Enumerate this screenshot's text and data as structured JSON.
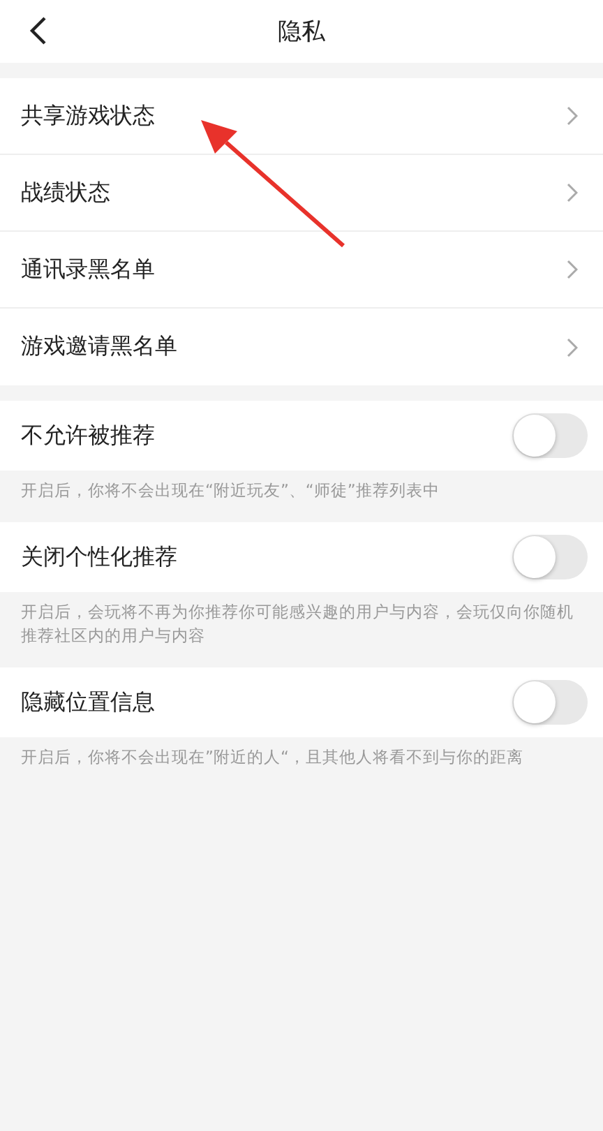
{
  "header": {
    "title": "隐私"
  },
  "nav_items": [
    {
      "label": "共享游戏状态"
    },
    {
      "label": "战绩状态"
    },
    {
      "label": "通讯录黑名单"
    },
    {
      "label": "游戏邀请黑名单"
    }
  ],
  "toggles": [
    {
      "label": "不允许被推荐",
      "on": false,
      "description": "开启后，你将不会出现在“附近玩友”、“师徒”推荐列表中"
    },
    {
      "label": "关闭个性化推荐",
      "on": false,
      "description": "开启后，会玩将不再为你推荐你可能感兴趣的用户与内容，会玩仅向你随机推荐社区内的用户与内容"
    },
    {
      "label": "隐藏位置信息",
      "on": false,
      "description": "开启后，你将不会出现在”附近的人“，且其他人将看不到与你的距离"
    }
  ]
}
